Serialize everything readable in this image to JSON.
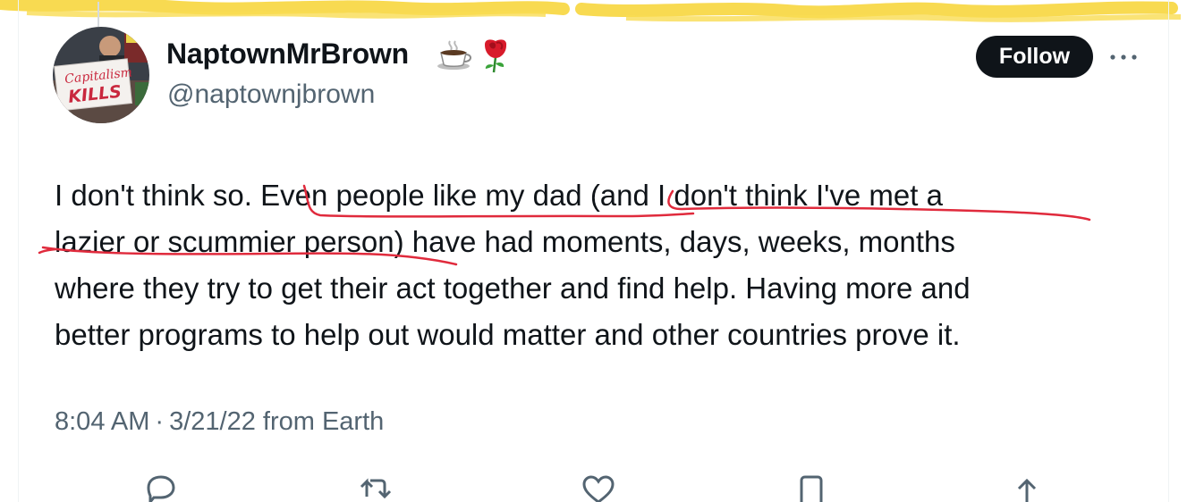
{
  "highlight_color": "#f7d332",
  "annotation_color": "#e02a3c",
  "user": {
    "display_name": "NaptownMrBrown",
    "emojis": [
      "coffee-icon",
      "rose-icon"
    ],
    "handle": "@naptownjbrown",
    "avatar_sign_text": "Capitalism KILLS"
  },
  "header": {
    "follow_label": "Follow",
    "more_icon": "more-horizontal-icon"
  },
  "tweet": {
    "lines": [
      "I don't think so. Even people like my dad (and I don't think I've met a",
      "lazier or scummier person) have had moments, days, weeks, months",
      "where they try to get their act together and find help. Having more and",
      "better programs to help out would matter and other countries prove it."
    ],
    "time": "8:04 AM",
    "date": "3/21/22",
    "source": "from Earth"
  },
  "actions": [
    "reply-icon",
    "retweet-icon",
    "like-icon",
    "bookmark-icon",
    "share-icon"
  ]
}
